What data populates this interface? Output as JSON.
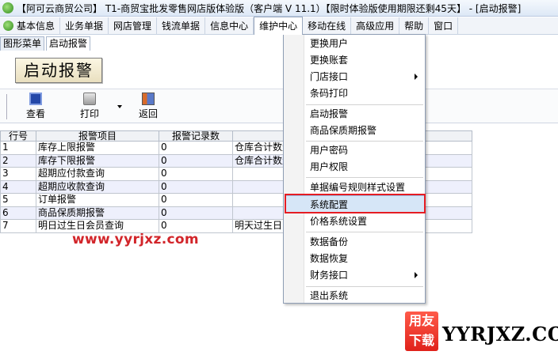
{
  "window": {
    "title": "【阿可云商贸公司】 T1-商贸宝批发零售网店版体验版（客户端 V 11.1）【限时体验版使用期限还剩45天】 - [启动报警]"
  },
  "menubar": {
    "items": [
      "基本信息",
      "业务单据",
      "网店管理",
      "钱流单据",
      "信息中心",
      "维护中心",
      "移动在线",
      "高级应用",
      "帮助",
      "窗口"
    ],
    "open_menu": "维护中心"
  },
  "tabs": [
    {
      "label": "图形菜单",
      "active": false
    },
    {
      "label": "启动报警",
      "active": true
    }
  ],
  "page_title": "启动报警",
  "toolbar": {
    "view_label": "查看",
    "print_label": "打印",
    "back_label": "返回"
  },
  "table": {
    "headers": [
      "行号",
      "报警项目",
      "报警记录数",
      ""
    ],
    "rows": [
      {
        "no": "1",
        "item": "库存上限报警",
        "count": "0",
        "desc": "仓库合计数量"
      },
      {
        "no": "2",
        "item": "库存下限报警",
        "count": "0",
        "desc": "仓库合计数量"
      },
      {
        "no": "3",
        "item": "超期应付款查询",
        "count": "0",
        "desc": ""
      },
      {
        "no": "4",
        "item": "超期应收款查询",
        "count": "0",
        "desc": ""
      },
      {
        "no": "5",
        "item": "订单报警",
        "count": "0",
        "desc": ""
      },
      {
        "no": "6",
        "item": "商品保质期报警",
        "count": "0",
        "desc": ""
      },
      {
        "no": "7",
        "item": "明日过生日会员查询",
        "count": "0",
        "desc": "明天过生日的"
      }
    ]
  },
  "dropdown": {
    "items": [
      "更换用户",
      "更换账套",
      "门店接口",
      "条码打印",
      "启动报警",
      "商品保质期报警",
      "用户密码",
      "用户权限",
      "单据编号规则样式设置",
      "系统配置",
      "价格系统设置",
      "数据备份",
      "数据恢复",
      "财务接口",
      "退出系统"
    ],
    "highlighted": "系统配置"
  },
  "watermark": {
    "url": "www.yyrjxz.com",
    "logo_top": "用友",
    "logo_bottom": "下载",
    "site": "YYRJXZ.COM"
  }
}
